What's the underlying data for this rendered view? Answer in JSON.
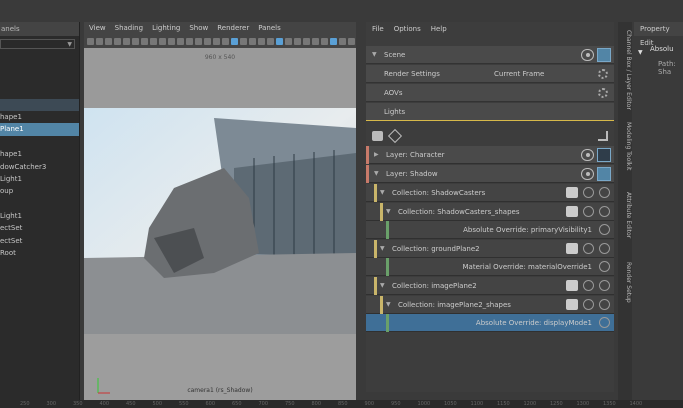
{
  "outliner": {
    "header": "anels",
    "items": [
      {
        "label": "",
        "sel": false
      },
      {
        "label": "",
        "sel": false
      },
      {
        "label": "",
        "sel": false
      },
      {
        "label": "",
        "sel": false
      },
      {
        "label": "",
        "sel": false
      },
      {
        "label": "hape1",
        "sel": false
      },
      {
        "label": "Plane1",
        "sel": true
      },
      {
        "label": "",
        "sel": false
      },
      {
        "label": "hape1",
        "sel": false
      },
      {
        "label": "dowCatcher3",
        "sel": false
      },
      {
        "label": "Light1",
        "sel": false
      },
      {
        "label": "oup",
        "sel": false
      },
      {
        "label": "",
        "sel": false
      },
      {
        "label": "Light1",
        "sel": false
      },
      {
        "label": "ectSet",
        "sel": false
      },
      {
        "label": "ectSet",
        "sel": false
      },
      {
        "label": "Root",
        "sel": false
      }
    ]
  },
  "viewport": {
    "menus": [
      "View",
      "Shading",
      "Lighting",
      "Show",
      "Renderer",
      "Panels"
    ],
    "resolution": "960 x 540",
    "camera": "camera1 (rs_Shadow)"
  },
  "render_setup": {
    "menus": [
      "File",
      "Options",
      "Help"
    ],
    "scene_label": "Scene",
    "render_settings_label": "Render Settings",
    "current_frame_label": "Current Frame",
    "aovs_label": "AOVs",
    "lights_label": "Lights",
    "layers": [
      {
        "label": "Layer:  Character",
        "color": "#c87a6a"
      },
      {
        "label": "Layer:  Shadow",
        "color": "#c87a6a"
      }
    ],
    "rows": [
      {
        "label": "Collection:  ShadowCasters",
        "indent": 1,
        "bar": "#c9b56a"
      },
      {
        "label": "Collection:  ShadowCasters_shapes",
        "indent": 2,
        "bar": "#c9b56a"
      },
      {
        "label": "Absolute Override:  primaryVisibility1",
        "indent": 3,
        "bar": "#6aa06a"
      },
      {
        "label": "Collection:  groundPlane2",
        "indent": 1,
        "bar": "#c9b56a"
      },
      {
        "label": "Material Override:  materialOverride1",
        "indent": 3,
        "bar": "#6aa06a"
      },
      {
        "label": "Collection:  imagePlane2",
        "indent": 1,
        "bar": "#c9b56a"
      },
      {
        "label": "Collection:  imagePlane2_shapes",
        "indent": 2,
        "bar": "#c9b56a"
      },
      {
        "label": "Absolute Override:  displayMode1",
        "indent": 3,
        "bar": "#6aa06a",
        "sel": true
      }
    ]
  },
  "right_tabs": [
    "Channel Box / Layer Editor",
    "Modeling Toolkit",
    "Attribute Editor",
    "Render Setup"
  ],
  "property_editor": {
    "title": "Property Edit",
    "item": "Absolu",
    "path": "Path: Sha"
  },
  "timeline": [
    "250",
    "300",
    "350",
    "400",
    "450",
    "500",
    "550",
    "600",
    "650",
    "700",
    "750",
    "800",
    "850",
    "900",
    "950",
    "1000",
    "1050",
    "1100",
    "1150",
    "1200",
    "1250",
    "1300",
    "1350",
    "1400"
  ]
}
